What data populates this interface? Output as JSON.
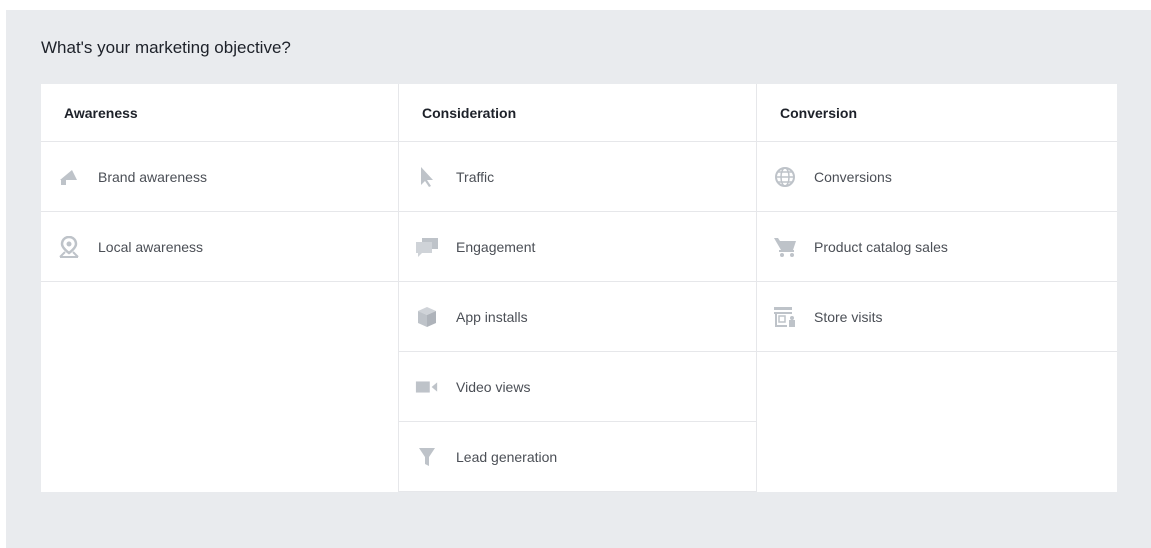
{
  "title": "What's your marketing objective?",
  "colors": {
    "icon": "#bec3c9",
    "background": "#e9ebee"
  },
  "columns": [
    {
      "heading": "Awareness",
      "items": [
        {
          "label": "Brand awareness",
          "icon": "megaphone-icon"
        },
        {
          "label": "Local awareness",
          "icon": "map-pin-icon"
        }
      ]
    },
    {
      "heading": "Consideration",
      "items": [
        {
          "label": "Traffic",
          "icon": "cursor-icon"
        },
        {
          "label": "Engagement",
          "icon": "speech-bubbles-icon"
        },
        {
          "label": "App installs",
          "icon": "box-icon"
        },
        {
          "label": "Video views",
          "icon": "video-camera-icon"
        },
        {
          "label": "Lead generation",
          "icon": "funnel-icon"
        }
      ]
    },
    {
      "heading": "Conversion",
      "items": [
        {
          "label": "Conversions",
          "icon": "globe-icon"
        },
        {
          "label": "Product catalog sales",
          "icon": "shopping-cart-icon"
        },
        {
          "label": "Store visits",
          "icon": "store-icon"
        }
      ]
    }
  ]
}
